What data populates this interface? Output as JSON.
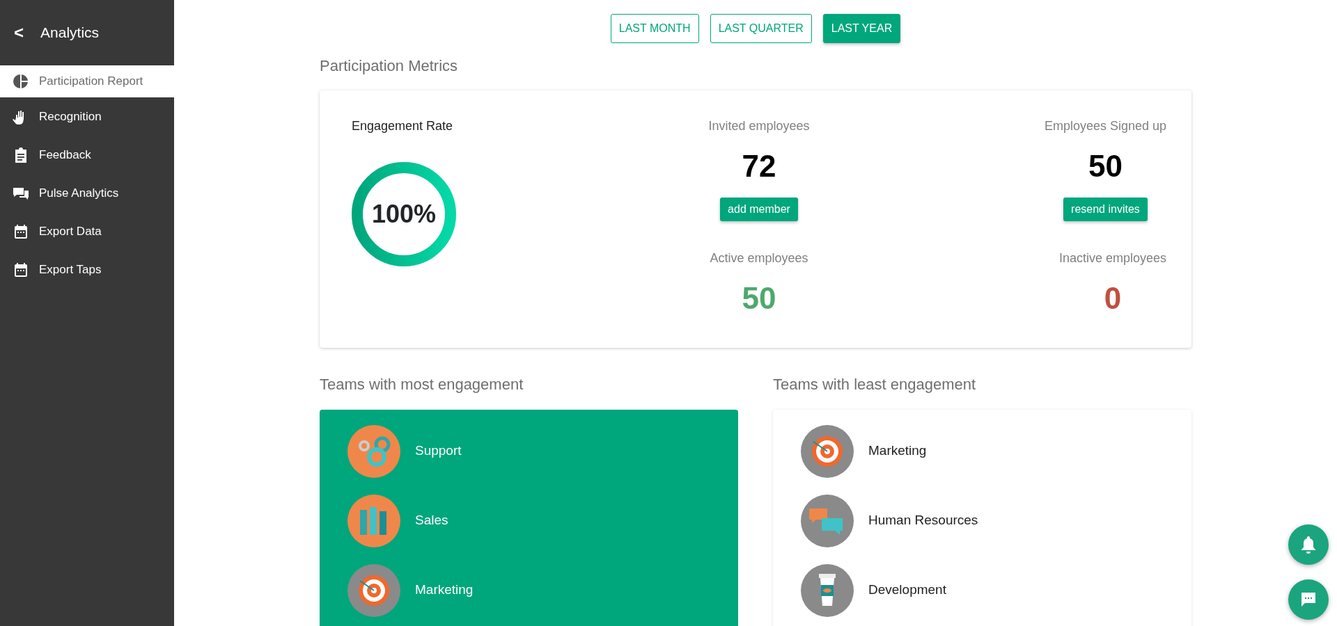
{
  "sidebar": {
    "back_icon": "<",
    "title": "Analytics",
    "items": [
      {
        "label": "Participation Report",
        "kind": "pie",
        "selected": true
      },
      {
        "label": "Recognition",
        "kind": "hand",
        "selected": false
      },
      {
        "label": "Feedback",
        "kind": "clipboard",
        "selected": false
      },
      {
        "label": "Pulse Analytics",
        "kind": "chat",
        "selected": false
      },
      {
        "label": "Export Data",
        "kind": "calendar",
        "selected": false
      },
      {
        "label": "Export Taps",
        "kind": "calendar",
        "selected": false
      }
    ]
  },
  "periods": [
    {
      "label": "LAST MONTH",
      "selected": false
    },
    {
      "label": "LAST QUARTER",
      "selected": false
    },
    {
      "label": "LAST YEAR",
      "selected": true
    }
  ],
  "metrics": {
    "title": "Participation Metrics",
    "gauge": {
      "label": "Engagement Rate",
      "reading": "100%",
      "level": 1
    },
    "stats": [
      {
        "label": "Invited employees",
        "value": "72",
        "action": "add member",
        "color": "#000000"
      },
      {
        "label": "Employees Signed up",
        "value": "50",
        "action": "resend invites",
        "color": "#000000"
      },
      {
        "label": "Active employees",
        "value": "50",
        "color": "#4ea96b"
      },
      {
        "label": "Inactive employees",
        "value": "0",
        "color": "#c0503f"
      }
    ]
  },
  "teams": [
    {
      "title": "Teams with most engagement",
      "highlight": true,
      "items": [
        {
          "name": "Support",
          "kind": "gears"
        },
        {
          "name": "Sales",
          "kind": "bars"
        },
        {
          "name": "Marketing",
          "kind": "target"
        }
      ]
    },
    {
      "title": "Teams with least engagement",
      "highlight": false,
      "items": [
        {
          "name": "Marketing",
          "kind": "target"
        },
        {
          "name": "Human Resources",
          "kind": "chat"
        },
        {
          "name": "Development",
          "kind": "cup"
        }
      ]
    }
  ]
}
